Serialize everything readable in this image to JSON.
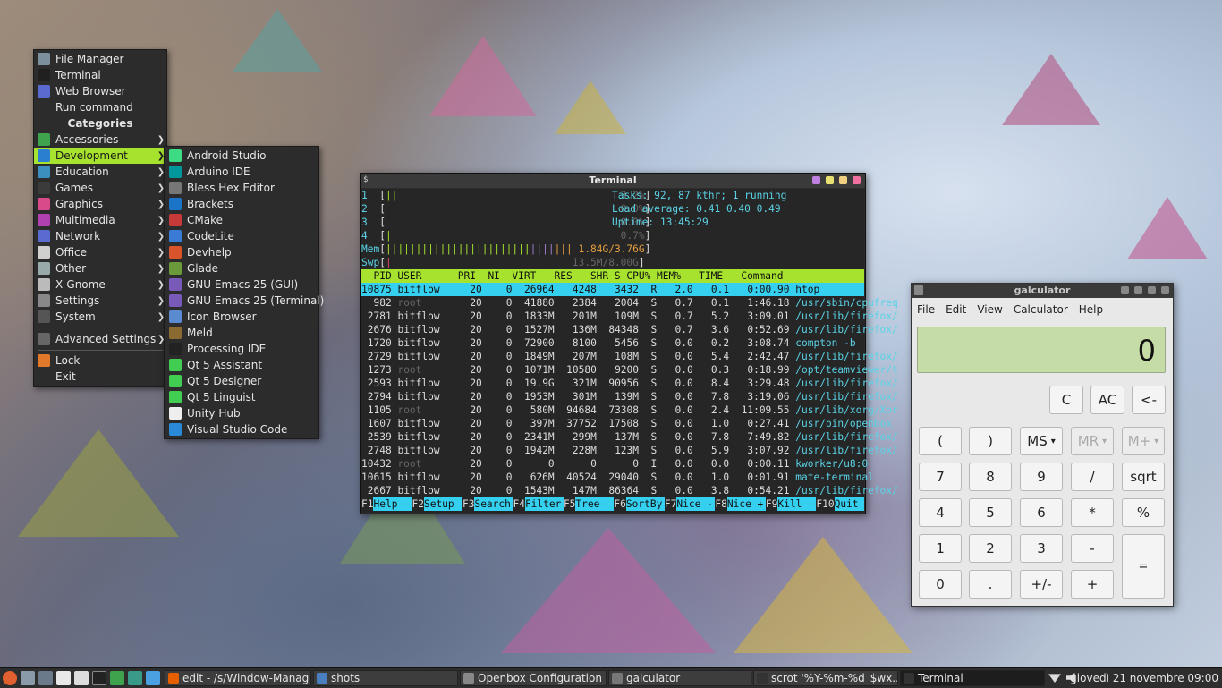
{
  "menu": {
    "top_items": [
      {
        "label": "File Manager",
        "icon": "folder-icon",
        "color": "#7c8f9c"
      },
      {
        "label": "Terminal",
        "icon": "terminal-icon",
        "color": "#202020"
      },
      {
        "label": "Web Browser",
        "icon": "globe-icon",
        "color": "#5a6ad0"
      },
      {
        "label": "Run command",
        "icon": "",
        "color": ""
      }
    ],
    "categories_title": "Categories",
    "categories": [
      {
        "label": "Accessories",
        "icon": "accessories-icon",
        "color": "#3fa34d"
      },
      {
        "label": "Development",
        "icon": "gear-icon",
        "color": "#2a7fd0",
        "active": true
      },
      {
        "label": "Education",
        "icon": "education-icon",
        "color": "#3a8fbf"
      },
      {
        "label": "Games",
        "icon": "games-icon",
        "color": "#3b3b3b"
      },
      {
        "label": "Graphics",
        "icon": "graphics-icon",
        "color": "#d84a8a"
      },
      {
        "label": "Multimedia",
        "icon": "multimedia-icon",
        "color": "#b040b0"
      },
      {
        "label": "Network",
        "icon": "network-icon",
        "color": "#5a6ad0"
      },
      {
        "label": "Office",
        "icon": "office-icon",
        "color": "#cfcfcf"
      },
      {
        "label": "Other",
        "icon": "other-icon",
        "color": "#9aa"
      },
      {
        "label": "X-Gnome",
        "icon": "xgnome-icon",
        "color": "#bbb"
      },
      {
        "label": "Settings",
        "icon": "settings-icon",
        "color": "#888"
      },
      {
        "label": "System",
        "icon": "system-icon",
        "color": "#555"
      }
    ],
    "advanced_settings": "Advanced Settings",
    "lock": "Lock",
    "exit": "Exit"
  },
  "submenu": [
    {
      "label": "Android Studio",
      "color": "#3ddc84"
    },
    {
      "label": "Arduino IDE",
      "color": "#00979c"
    },
    {
      "label": "Bless Hex Editor",
      "color": "#777"
    },
    {
      "label": "Brackets",
      "color": "#1c74c9"
    },
    {
      "label": "CMake",
      "color": "#c83a3a"
    },
    {
      "label": "CodeLite",
      "color": "#3a7bd5"
    },
    {
      "label": "Devhelp",
      "color": "#d9542b"
    },
    {
      "label": "Glade",
      "color": "#6a9a3a"
    },
    {
      "label": "GNU Emacs 25 (GUI)",
      "color": "#7a5ab8"
    },
    {
      "label": "GNU Emacs 25 (Terminal)",
      "color": "#7a5ab8"
    },
    {
      "label": "Icon Browser",
      "color": "#5a8ad0"
    },
    {
      "label": "Meld",
      "color": "#8a6a30"
    },
    {
      "label": "Processing IDE",
      "color": "#222"
    },
    {
      "label": "Qt 5 Assistant",
      "color": "#41cd52"
    },
    {
      "label": "Qt 5 Designer",
      "color": "#41cd52"
    },
    {
      "label": "Qt 5 Linguist",
      "color": "#41cd52"
    },
    {
      "label": "Unity Hub",
      "color": "#eeeeee"
    },
    {
      "label": "Visual Studio Code",
      "color": "#2a8ad8"
    }
  ],
  "terminal": {
    "title": "Terminal",
    "cpu_rows": [
      {
        "id": "1",
        "bar": "||",
        "val": "3.2%"
      },
      {
        "id": "2",
        "bar": "",
        "val": "0.0%"
      },
      {
        "id": "3",
        "bar": "",
        "val": "0.0%"
      },
      {
        "id": "4",
        "bar": "|",
        "val": "0.7%"
      }
    ],
    "mem_label": "Mem",
    "mem_val": "1.84G/3.76G",
    "swp_label": "Swp",
    "swp_val": "13.5M/8.00G",
    "tasks": "Tasks: 92, 87 kthr; 1 running",
    "load": "Load average: 0.41 0.40 0.49",
    "uptime": "Uptime: 13:45:29",
    "header": "  PID USER      PRI  NI  VIRT   RES   SHR S CPU% MEM%   TIME+  Command",
    "processes": [
      {
        "pid": "10875",
        "user": "bitflow",
        "pri": "20",
        "ni": "0",
        "virt": "26964",
        "res": "4248",
        "shr": "3432",
        "s": "R",
        "cpu": "2.0",
        "mem": "0.1",
        "time": "0:00.90",
        "cmd": "htop",
        "sel": true
      },
      {
        "pid": "982",
        "user": "root",
        "pri": "20",
        "ni": "0",
        "virt": "41880",
        "res": "2384",
        "shr": "2004",
        "s": "S",
        "cpu": "0.7",
        "mem": "0.1",
        "time": "1:46.18",
        "cmd": "/usr/sbin/cpufreq"
      },
      {
        "pid": "2781",
        "user": "bitflow",
        "pri": "20",
        "ni": "0",
        "virt": "1833M",
        "res": "201M",
        "shr": "109M",
        "s": "S",
        "cpu": "0.7",
        "mem": "5.2",
        "time": "3:09.01",
        "cmd": "/usr/lib/firefox/"
      },
      {
        "pid": "2676",
        "user": "bitflow",
        "pri": "20",
        "ni": "0",
        "virt": "1527M",
        "res": "136M",
        "shr": "84348",
        "s": "S",
        "cpu": "0.7",
        "mem": "3.6",
        "time": "0:52.69",
        "cmd": "/usr/lib/firefox/"
      },
      {
        "pid": "1720",
        "user": "bitflow",
        "pri": "20",
        "ni": "0",
        "virt": "72900",
        "res": "8100",
        "shr": "5456",
        "s": "S",
        "cpu": "0.0",
        "mem": "0.2",
        "time": "3:08.74",
        "cmd": "compton -b"
      },
      {
        "pid": "2729",
        "user": "bitflow",
        "pri": "20",
        "ni": "0",
        "virt": "1849M",
        "res": "207M",
        "shr": "108M",
        "s": "S",
        "cpu": "0.0",
        "mem": "5.4",
        "time": "2:42.47",
        "cmd": "/usr/lib/firefox/"
      },
      {
        "pid": "1273",
        "user": "root",
        "pri": "20",
        "ni": "0",
        "virt": "1071M",
        "res": "10580",
        "shr": "9200",
        "s": "S",
        "cpu": "0.0",
        "mem": "0.3",
        "time": "0:18.99",
        "cmd": "/opt/teamviewer/t"
      },
      {
        "pid": "2593",
        "user": "bitflow",
        "pri": "20",
        "ni": "0",
        "virt": "19.9G",
        "res": "321M",
        "shr": "90956",
        "s": "S",
        "cpu": "0.0",
        "mem": "8.4",
        "time": "3:29.48",
        "cmd": "/usr/lib/firefox/"
      },
      {
        "pid": "2794",
        "user": "bitflow",
        "pri": "20",
        "ni": "0",
        "virt": "1953M",
        "res": "301M",
        "shr": "139M",
        "s": "S",
        "cpu": "0.0",
        "mem": "7.8",
        "time": "3:19.06",
        "cmd": "/usr/lib/firefox/"
      },
      {
        "pid": "1105",
        "user": "root",
        "pri": "20",
        "ni": "0",
        "virt": "580M",
        "res": "94684",
        "shr": "73308",
        "s": "S",
        "cpu": "0.0",
        "mem": "2.4",
        "time": "11:09.55",
        "cmd": "/usr/lib/xorg/Xor"
      },
      {
        "pid": "1607",
        "user": "bitflow",
        "pri": "20",
        "ni": "0",
        "virt": "397M",
        "res": "37752",
        "shr": "17508",
        "s": "S",
        "cpu": "0.0",
        "mem": "1.0",
        "time": "0:27.41",
        "cmd": "/usr/bin/openbox"
      },
      {
        "pid": "2539",
        "user": "bitflow",
        "pri": "20",
        "ni": "0",
        "virt": "2341M",
        "res": "299M",
        "shr": "137M",
        "s": "S",
        "cpu": "0.0",
        "mem": "7.8",
        "time": "7:49.82",
        "cmd": "/usr/lib/firefox/"
      },
      {
        "pid": "2748",
        "user": "bitflow",
        "pri": "20",
        "ni": "0",
        "virt": "1942M",
        "res": "228M",
        "shr": "123M",
        "s": "S",
        "cpu": "0.0",
        "mem": "5.9",
        "time": "3:07.92",
        "cmd": "/usr/lib/firefox/"
      },
      {
        "pid": "10432",
        "user": "root",
        "pri": "20",
        "ni": "0",
        "virt": "0",
        "res": "0",
        "shr": "0",
        "s": "I",
        "cpu": "0.0",
        "mem": "0.0",
        "time": "0:00.11",
        "cmd": "kworker/u8:0"
      },
      {
        "pid": "10615",
        "user": "bitflow",
        "pri": "20",
        "ni": "0",
        "virt": "626M",
        "res": "40524",
        "shr": "29040",
        "s": "S",
        "cpu": "0.0",
        "mem": "1.0",
        "time": "0:01.91",
        "cmd": "mate-terminal"
      },
      {
        "pid": "2667",
        "user": "bitflow",
        "pri": "20",
        "ni": "0",
        "virt": "1543M",
        "res": "147M",
        "shr": "86364",
        "s": "S",
        "cpu": "0.0",
        "mem": "3.8",
        "time": "0:54.21",
        "cmd": "/usr/lib/firefox/"
      }
    ],
    "fkeys": [
      {
        "k": "F1",
        "l": "Help"
      },
      {
        "k": "F2",
        "l": "Setup"
      },
      {
        "k": "F3",
        "l": "Search"
      },
      {
        "k": "F4",
        "l": "Filter"
      },
      {
        "k": "F5",
        "l": "Tree"
      },
      {
        "k": "F6",
        "l": "SortBy"
      },
      {
        "k": "F7",
        "l": "Nice -"
      },
      {
        "k": "F8",
        "l": "Nice +"
      },
      {
        "k": "F9",
        "l": "Kill"
      },
      {
        "k": "F10",
        "l": "Quit"
      }
    ]
  },
  "calculator": {
    "title": "galculator",
    "menus": [
      "File",
      "Edit",
      "View",
      "Calculator",
      "Help"
    ],
    "display": "0",
    "top_buttons": [
      "C",
      "AC",
      "<-"
    ],
    "row_paren": [
      "(",
      ")",
      "MS",
      "MR",
      "M+"
    ],
    "rows": [
      [
        "7",
        "8",
        "9",
        "/",
        "sqrt"
      ],
      [
        "4",
        "5",
        "6",
        "*",
        "%"
      ],
      [
        "1",
        "2",
        "3",
        "-",
        "="
      ],
      [
        "0",
        ".",
        "+/-",
        "+",
        ""
      ]
    ]
  },
  "taskbar": {
    "tasks": [
      {
        "label": "edit - /s/Window-Manag...",
        "color": "#e66000"
      },
      {
        "label": "shots",
        "color": "#4a7fbf"
      },
      {
        "label": "Openbox Configuration ...",
        "color": "#888"
      },
      {
        "label": "galculator",
        "color": "#777"
      },
      {
        "label": "scrot '%Y-%m-%d_$wx...",
        "color": "#333"
      },
      {
        "label": "Terminal",
        "color": "#333"
      }
    ],
    "clock": "giovedì 21 novembre 09:00"
  }
}
